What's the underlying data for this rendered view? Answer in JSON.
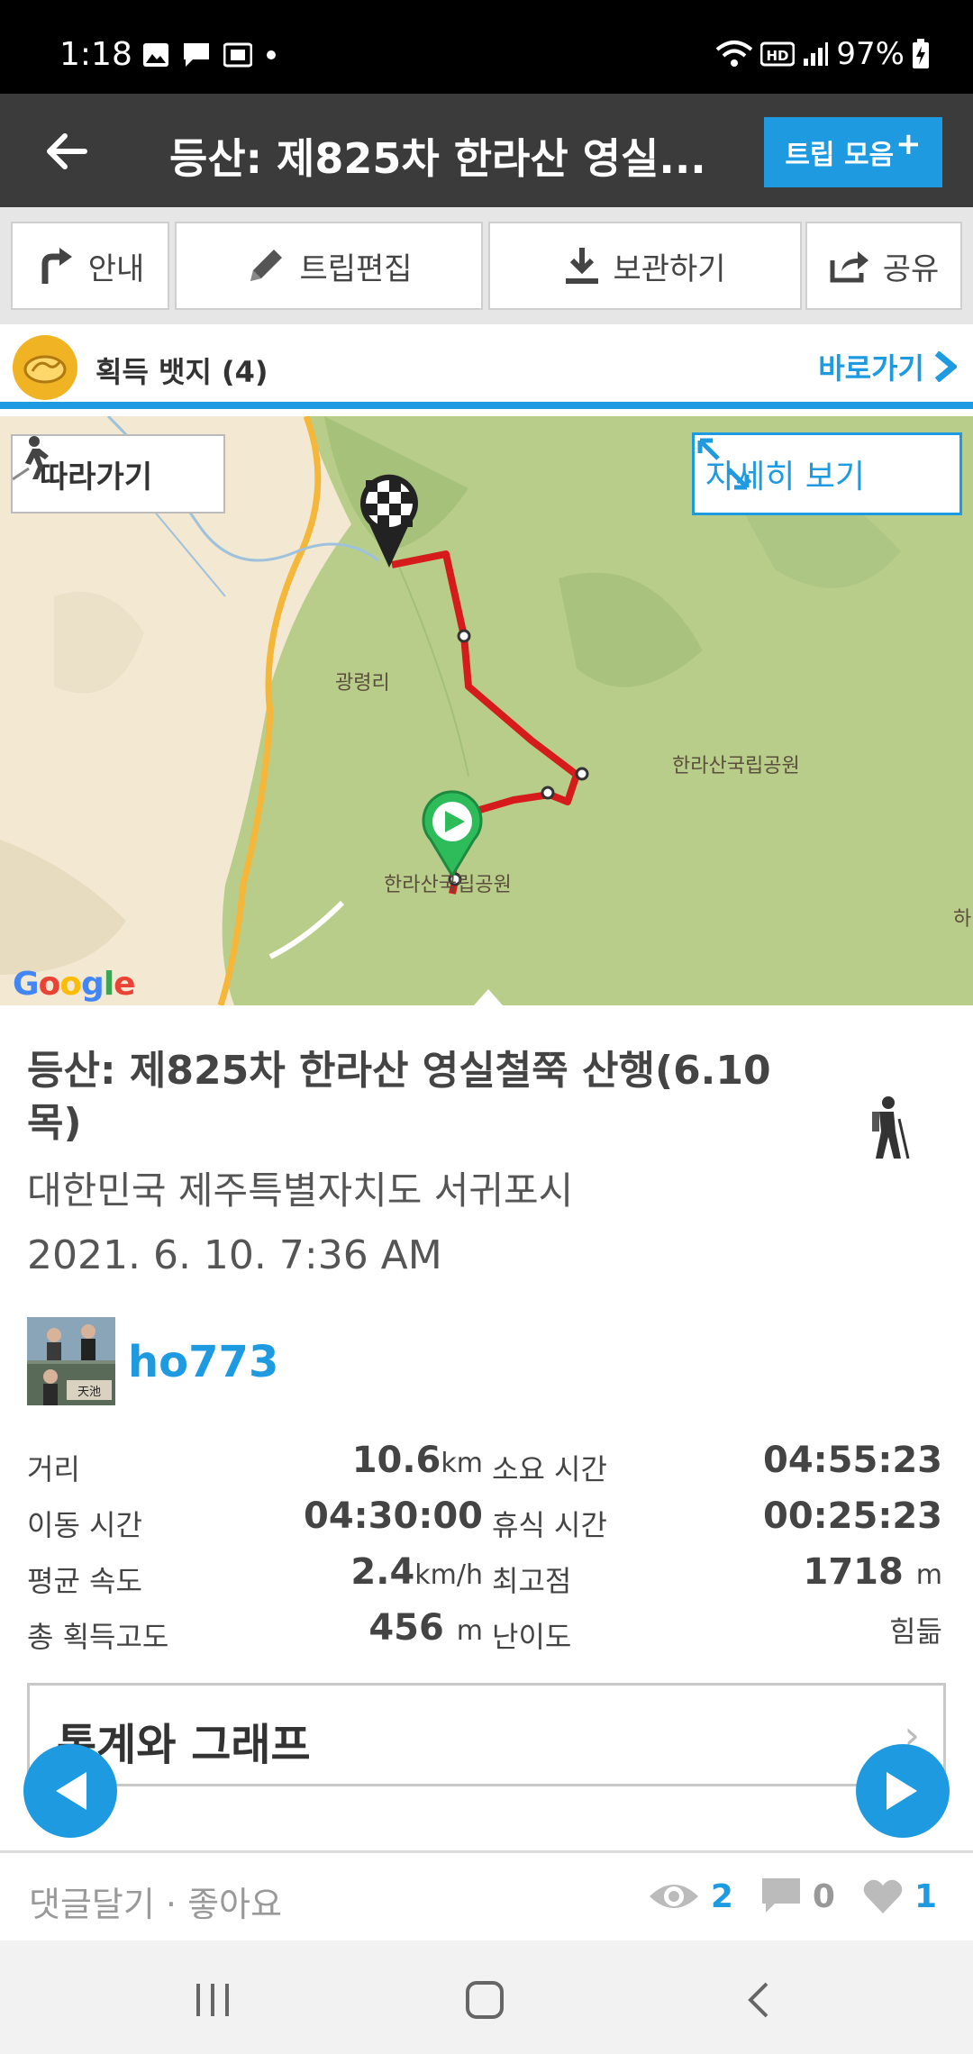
{
  "status_bar": {
    "time": "1:18",
    "battery": "97%"
  },
  "app_bar": {
    "title": "등산: 제825차 한라산 영실...",
    "trip_collection_button": "트립 모음",
    "trip_collection_plus": "+"
  },
  "toolbar": {
    "guide": "안내",
    "edit_trip": "트립편집",
    "save": "보관하기",
    "share": "공유"
  },
  "badges": {
    "label": "획득 뱃지 (4)",
    "shortcut": "바로가기"
  },
  "map": {
    "follow_button": "따라가기",
    "detail_button": "자세히 보기",
    "labels": {
      "village": "광령리",
      "park_right": "한라산국립공원",
      "park_bottom": "한라산국립공원",
      "edge": "하"
    },
    "google": [
      "G",
      "o",
      "o",
      "g",
      "l",
      "e"
    ]
  },
  "trip": {
    "title": "등산: 제825차 한라산 영실철쭉 산행(6.10 목)",
    "location": "대한민국 제주특별자치도 서귀포시",
    "datetime": "2021. 6. 10. 7:36 AM",
    "username": "ho773",
    "avatar_caption": "天池"
  },
  "stats": {
    "distance_label": "거리",
    "distance_value": "10.6",
    "distance_unit": "km",
    "duration_label": "소요 시간",
    "duration_value": "04:55:23",
    "moving_time_label": "이동 시간",
    "moving_time_value": "04:30:00",
    "rest_time_label": "휴식 시간",
    "rest_time_value": "00:25:23",
    "avg_speed_label": "평균 속도",
    "avg_speed_value": "2.4",
    "avg_speed_unit": "km/h",
    "max_elev_label": "최고점",
    "max_elev_value": "1718",
    "max_elev_unit": "m",
    "total_ascent_label": "총 획득고도",
    "total_ascent_value": "456",
    "total_ascent_unit": "m",
    "difficulty_label": "난이도",
    "difficulty_value": "힘듦"
  },
  "stats_graph": {
    "label": "통계와 그래프",
    "chevron": "›"
  },
  "footer": {
    "comment_like": "댓글달기 · 좋아요",
    "views": "2",
    "comments": "0",
    "likes": "1"
  },
  "colors": {
    "accent": "#1e9be0",
    "appbar": "#3b3b3b",
    "route": "#d51b1b",
    "badge": "#f0b323"
  },
  "icons": {
    "back": "arrow-left-icon",
    "guide": "turn-right-icon",
    "edit": "pencil-icon",
    "save": "download-icon",
    "share": "share-icon",
    "badge": "badge-medal-icon",
    "follow": "walker-icon",
    "detail": "expand-icon",
    "activity": "hiker-icon",
    "prev": "play-left-icon",
    "next": "play-right-icon",
    "views": "eye-icon",
    "comments": "comment-icon",
    "likes": "heart-icon"
  }
}
